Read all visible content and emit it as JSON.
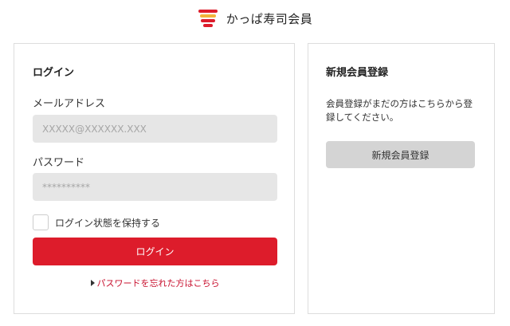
{
  "header": {
    "brand_name": "かっぱ寿司会員",
    "logo_icon": "kappa-sushi-logo-icon",
    "accent_color": "#dd1c2b"
  },
  "login": {
    "title": "ログイン",
    "email_label": "メールアドレス",
    "email_placeholder": "XXXXX@XXXXXX.XXX",
    "email_value": "",
    "password_label": "パスワード",
    "password_placeholder": "**********",
    "password_value": "",
    "remember_label": "ログイン状態を保持する",
    "remember_checked": false,
    "submit_label": "ログイン",
    "forgot_link": "パスワードを忘れた方はこちら"
  },
  "register": {
    "title": "新規会員登録",
    "description": "会員登録がまだの方はこちらから登録してください。",
    "button_label": "新規会員登録"
  }
}
